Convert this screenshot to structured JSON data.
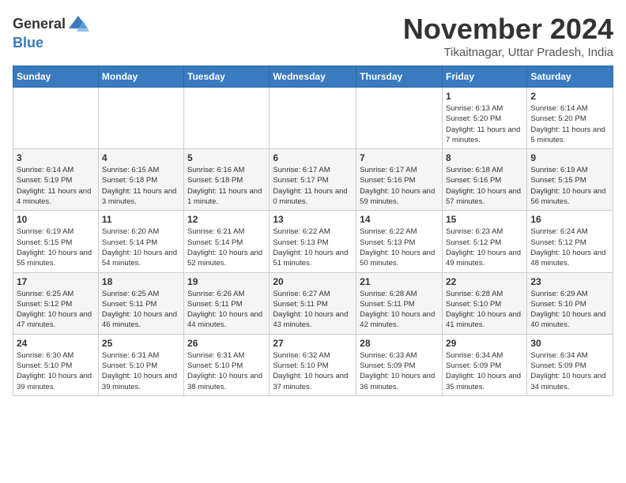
{
  "header": {
    "logo_general": "General",
    "logo_blue": "Blue",
    "month_year": "November 2024",
    "location": "Tikaitnagar, Uttar Pradesh, India"
  },
  "weekdays": [
    "Sunday",
    "Monday",
    "Tuesday",
    "Wednesday",
    "Thursday",
    "Friday",
    "Saturday"
  ],
  "weeks": [
    [
      {
        "day": "",
        "info": ""
      },
      {
        "day": "",
        "info": ""
      },
      {
        "day": "",
        "info": ""
      },
      {
        "day": "",
        "info": ""
      },
      {
        "day": "",
        "info": ""
      },
      {
        "day": "1",
        "info": "Sunrise: 6:13 AM\nSunset: 5:20 PM\nDaylight: 11 hours and 7 minutes."
      },
      {
        "day": "2",
        "info": "Sunrise: 6:14 AM\nSunset: 5:20 PM\nDaylight: 11 hours and 5 minutes."
      }
    ],
    [
      {
        "day": "3",
        "info": "Sunrise: 6:14 AM\nSunset: 5:19 PM\nDaylight: 11 hours and 4 minutes."
      },
      {
        "day": "4",
        "info": "Sunrise: 6:15 AM\nSunset: 5:18 PM\nDaylight: 11 hours and 3 minutes."
      },
      {
        "day": "5",
        "info": "Sunrise: 6:16 AM\nSunset: 5:18 PM\nDaylight: 11 hours and 1 minute."
      },
      {
        "day": "6",
        "info": "Sunrise: 6:17 AM\nSunset: 5:17 PM\nDaylight: 11 hours and 0 minutes."
      },
      {
        "day": "7",
        "info": "Sunrise: 6:17 AM\nSunset: 5:16 PM\nDaylight: 10 hours and 59 minutes."
      },
      {
        "day": "8",
        "info": "Sunrise: 6:18 AM\nSunset: 5:16 PM\nDaylight: 10 hours and 57 minutes."
      },
      {
        "day": "9",
        "info": "Sunrise: 6:19 AM\nSunset: 5:15 PM\nDaylight: 10 hours and 56 minutes."
      }
    ],
    [
      {
        "day": "10",
        "info": "Sunrise: 6:19 AM\nSunset: 5:15 PM\nDaylight: 10 hours and 55 minutes."
      },
      {
        "day": "11",
        "info": "Sunrise: 6:20 AM\nSunset: 5:14 PM\nDaylight: 10 hours and 54 minutes."
      },
      {
        "day": "12",
        "info": "Sunrise: 6:21 AM\nSunset: 5:14 PM\nDaylight: 10 hours and 52 minutes."
      },
      {
        "day": "13",
        "info": "Sunrise: 6:22 AM\nSunset: 5:13 PM\nDaylight: 10 hours and 51 minutes."
      },
      {
        "day": "14",
        "info": "Sunrise: 6:22 AM\nSunset: 5:13 PM\nDaylight: 10 hours and 50 minutes."
      },
      {
        "day": "15",
        "info": "Sunrise: 6:23 AM\nSunset: 5:12 PM\nDaylight: 10 hours and 49 minutes."
      },
      {
        "day": "16",
        "info": "Sunrise: 6:24 AM\nSunset: 5:12 PM\nDaylight: 10 hours and 48 minutes."
      }
    ],
    [
      {
        "day": "17",
        "info": "Sunrise: 6:25 AM\nSunset: 5:12 PM\nDaylight: 10 hours and 47 minutes."
      },
      {
        "day": "18",
        "info": "Sunrise: 6:25 AM\nSunset: 5:11 PM\nDaylight: 10 hours and 46 minutes."
      },
      {
        "day": "19",
        "info": "Sunrise: 6:26 AM\nSunset: 5:11 PM\nDaylight: 10 hours and 44 minutes."
      },
      {
        "day": "20",
        "info": "Sunrise: 6:27 AM\nSunset: 5:11 PM\nDaylight: 10 hours and 43 minutes."
      },
      {
        "day": "21",
        "info": "Sunrise: 6:28 AM\nSunset: 5:11 PM\nDaylight: 10 hours and 42 minutes."
      },
      {
        "day": "22",
        "info": "Sunrise: 6:28 AM\nSunset: 5:10 PM\nDaylight: 10 hours and 41 minutes."
      },
      {
        "day": "23",
        "info": "Sunrise: 6:29 AM\nSunset: 5:10 PM\nDaylight: 10 hours and 40 minutes."
      }
    ],
    [
      {
        "day": "24",
        "info": "Sunrise: 6:30 AM\nSunset: 5:10 PM\nDaylight: 10 hours and 39 minutes."
      },
      {
        "day": "25",
        "info": "Sunrise: 6:31 AM\nSunset: 5:10 PM\nDaylight: 10 hours and 39 minutes."
      },
      {
        "day": "26",
        "info": "Sunrise: 6:31 AM\nSunset: 5:10 PM\nDaylight: 10 hours and 38 minutes."
      },
      {
        "day": "27",
        "info": "Sunrise: 6:32 AM\nSunset: 5:10 PM\nDaylight: 10 hours and 37 minutes."
      },
      {
        "day": "28",
        "info": "Sunrise: 6:33 AM\nSunset: 5:09 PM\nDaylight: 10 hours and 36 minutes."
      },
      {
        "day": "29",
        "info": "Sunrise: 6:34 AM\nSunset: 5:09 PM\nDaylight: 10 hours and 35 minutes."
      },
      {
        "day": "30",
        "info": "Sunrise: 6:34 AM\nSunset: 5:09 PM\nDaylight: 10 hours and 34 minutes."
      }
    ]
  ]
}
